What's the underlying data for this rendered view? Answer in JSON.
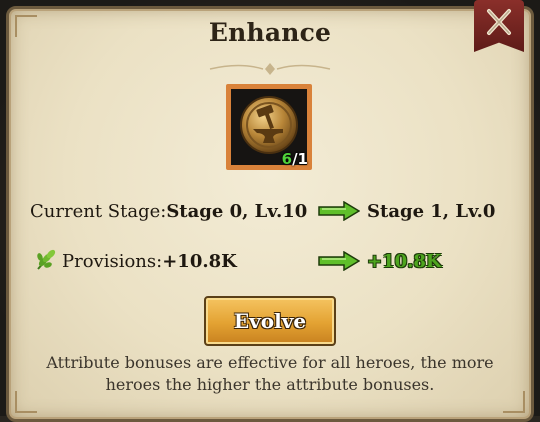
{
  "dialog": {
    "title": "Enhance",
    "close_icon": "close-x-icon"
  },
  "item": {
    "icon": "anvil-hammer-medal-icon",
    "count_have": "6",
    "count_sep_need": "/1"
  },
  "stage": {
    "label": "Current Stage:",
    "current": "Stage 0, Lv.10",
    "next": "Stage 1, Lv.0"
  },
  "provisions": {
    "icon": "wheat-icon",
    "label": "Provisions:",
    "current": "+10.8K",
    "next": "+10.8K"
  },
  "evolve_button": {
    "label": "Evolve"
  },
  "description": "Attribute bonuses are effective for all heroes, the more heroes the higher the attribute bonuses.",
  "colors": {
    "panel": "#ebe1c4",
    "frame_orange": "#d9823a",
    "green_value": "#4ea51f",
    "button_gold": "#e3a232",
    "close_red": "#8a2f2a"
  }
}
